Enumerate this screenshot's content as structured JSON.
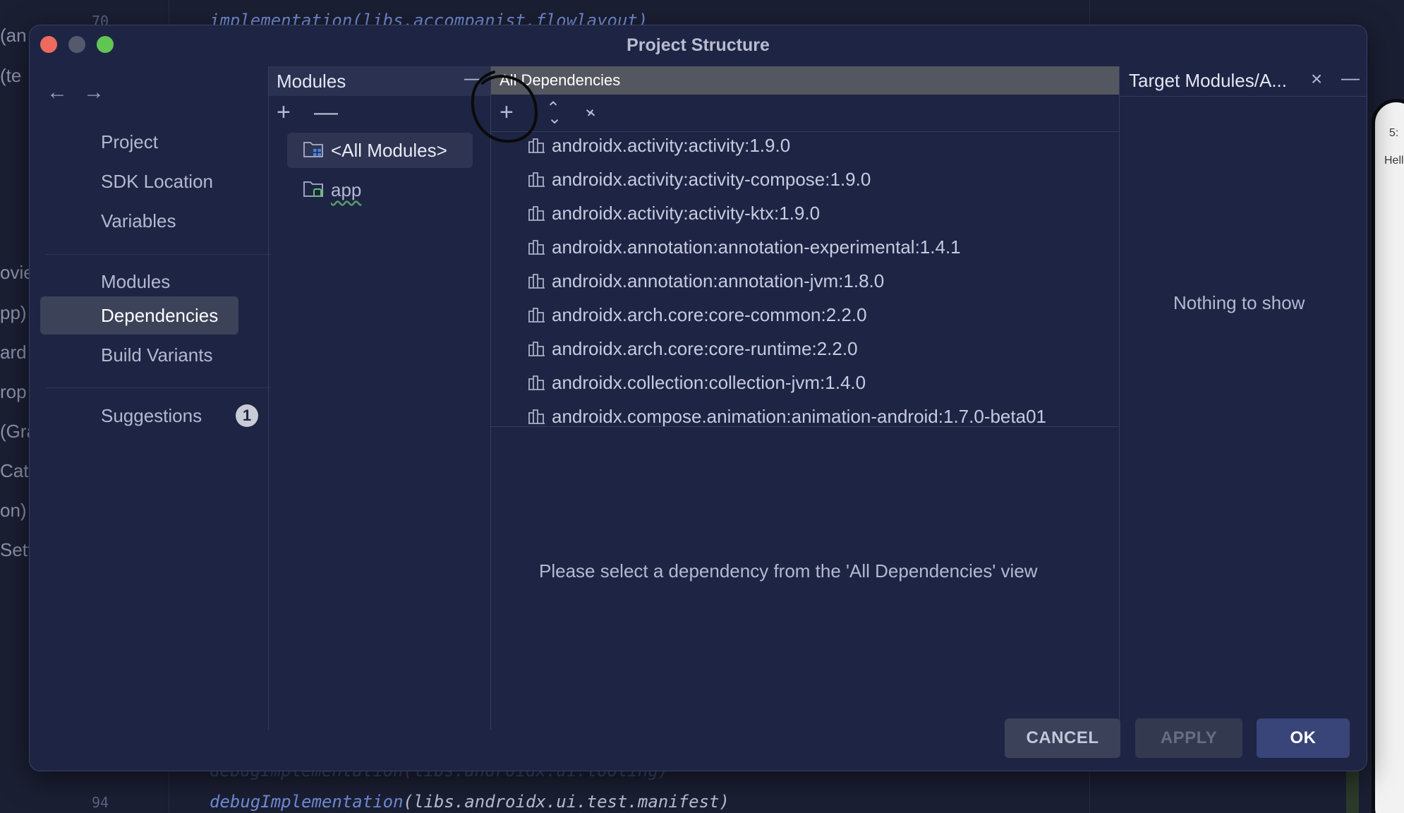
{
  "ide": {
    "line_top": "70",
    "code_top": "implementation(libs.accompanist.flowlayout)",
    "line_bottom": "94",
    "code_bottom_fn": "debugImplementation",
    "code_bottom_arg": "(libs.androidx.ui.test.manifest)",
    "code_bottom_faded": "debugImplementation(libs.androidx.ui.tooling)",
    "side_fragments": [
      "(an",
      "(te",
      "ovie",
      "pp)",
      "ard",
      "rop",
      "(Gra",
      "Cata",
      "on)",
      "Sett"
    ],
    "device_text_1": "5:",
    "device_text_2": "Hell"
  },
  "dialog": {
    "title": "Project Structure",
    "nav": {
      "back_icon": "arrow-left-icon",
      "forward_icon": "arrow-right-icon"
    },
    "sidebar": {
      "items": [
        {
          "label": "Project"
        },
        {
          "label": "SDK Location"
        },
        {
          "label": "Variables"
        },
        {
          "label": "Modules"
        },
        {
          "label": "Dependencies",
          "active": true
        },
        {
          "label": "Build Variants"
        },
        {
          "label": "Suggestions",
          "badge": "1"
        }
      ]
    },
    "modules_panel": {
      "title": "Modules",
      "modules": [
        {
          "label": "<All Modules>",
          "selected": true
        },
        {
          "label": "app"
        }
      ]
    },
    "dependencies_panel": {
      "title": "All Dependencies",
      "items": [
        "androidx.activity:activity:1.9.0",
        "androidx.activity:activity-compose:1.9.0",
        "androidx.activity:activity-ktx:1.9.0",
        "androidx.annotation:annotation-experimental:1.4.1",
        "androidx.annotation:annotation-jvm:1.8.0",
        "androidx.arch.core:core-common:2.2.0",
        "androidx.arch.core:core-runtime:2.2.0",
        "androidx.collection:collection-jvm:1.4.0",
        "androidx.compose.animation:animation-android:1.7.0-beta01"
      ],
      "detail_empty_message": "Please select a dependency from the 'All Dependencies' view"
    },
    "target_panel": {
      "title": "Target Modules/A...",
      "empty_message": "Nothing to show"
    },
    "buttons": {
      "cancel": "CANCEL",
      "apply": "APPLY",
      "ok": "OK"
    },
    "colors": {
      "dialog_bg": "#1e2443",
      "selection_bg": "#3c4258",
      "ok_button": "#394478",
      "close_light": "#ed6a5e",
      "maximize_light": "#61c554"
    }
  }
}
